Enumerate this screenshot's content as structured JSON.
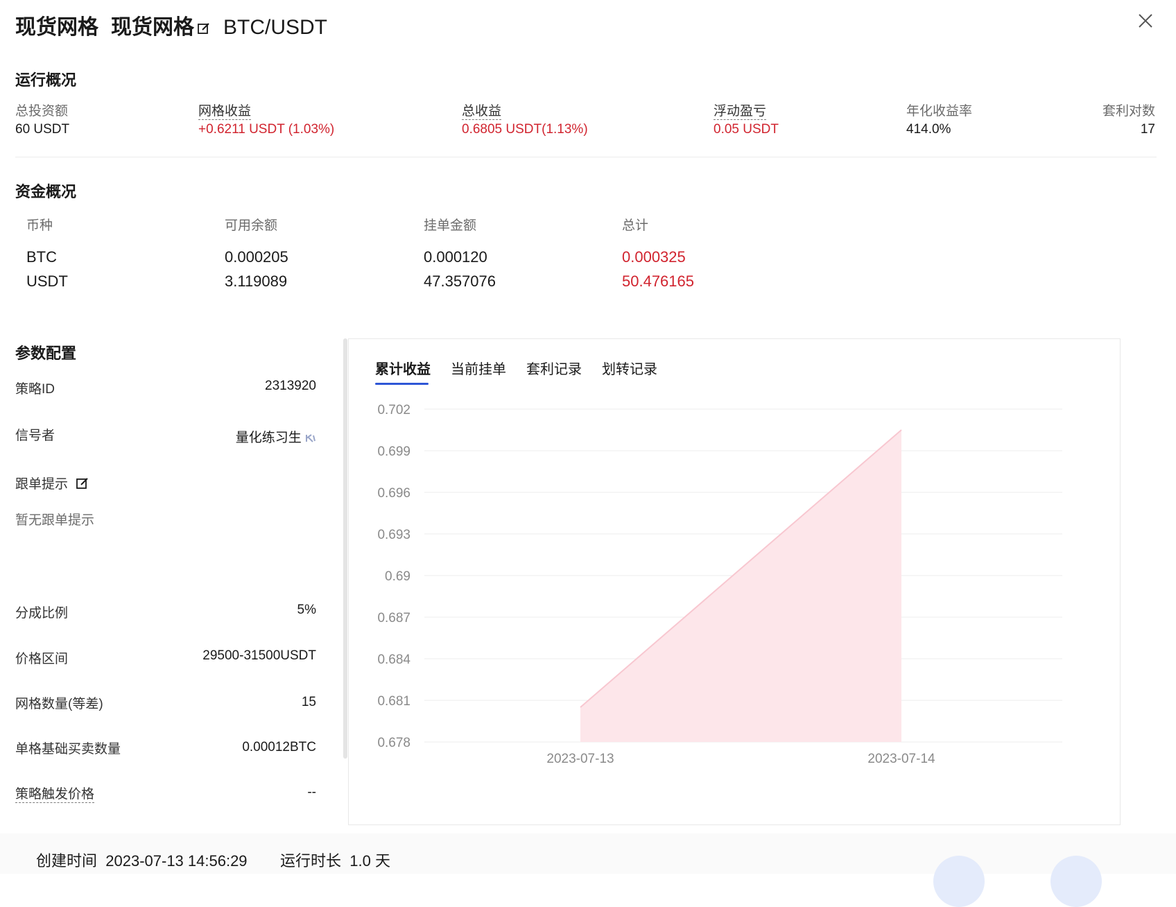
{
  "header": {
    "title_main": "现货网格",
    "title_sub": "现货网格",
    "pair": "BTC/USDT"
  },
  "overview": {
    "title": "运行概况",
    "items": [
      {
        "label": "总投资额",
        "value": "60 USDT"
      },
      {
        "label": "网格收益",
        "value": "+0.6211 USDT (1.03%)"
      },
      {
        "label": "总收益",
        "value": "0.6805 USDT(1.13%)"
      },
      {
        "label": "浮动盈亏",
        "value": "0.05 USDT"
      },
      {
        "label": "年化收益率",
        "value": "414.0%"
      },
      {
        "label": "套利对数",
        "value": "17"
      }
    ]
  },
  "funds": {
    "title": "资金概况",
    "headers": [
      "币种",
      "可用余额",
      "挂单金额",
      "总计"
    ],
    "rows": [
      [
        "BTC",
        "0.000205",
        "0.000120",
        "0.000325"
      ],
      [
        "USDT",
        "3.119089",
        "47.357076",
        "50.476165"
      ]
    ]
  },
  "params": {
    "title": "参数配置",
    "strategy_id_label": "策略ID",
    "strategy_id": "2313920",
    "signaler_label": "信号者",
    "signaler": "量化练习生",
    "tip_label": "跟单提示",
    "tip_empty": "暂无跟单提示",
    "share_label": "分成比例",
    "share": "5%",
    "range_label": "价格区间",
    "range": "29500-31500USDT",
    "grids_label": "网格数量(等差)",
    "grids": "15",
    "qty_label": "单格基础买卖数量",
    "qty": "0.00012BTC",
    "trigger_label": "策略触发价格",
    "trigger": "--"
  },
  "tabs": [
    "累计收益",
    "当前挂单",
    "套利记录",
    "划转记录"
  ],
  "chart_data": {
    "type": "area",
    "x": [
      "2023-07-13",
      "2023-07-14"
    ],
    "series": [
      {
        "values": [
          0.6805,
          0.7005
        ]
      }
    ],
    "y_ticks": [
      "0.702",
      "0.699",
      "0.696",
      "0.693",
      "0.69",
      "0.687",
      "0.684",
      "0.681",
      "0.678"
    ],
    "ylim": [
      0.678,
      0.702
    ],
    "grid": true,
    "colors": {
      "fill": "#fde6ea",
      "line": "#f8c7d0"
    }
  },
  "footer": {
    "created_label": "创建时间",
    "created": "2023-07-13 14:56:29",
    "runtime_label": "运行时长",
    "runtime": "1.0 天"
  },
  "colors": {
    "accent": "#2e56d6",
    "positive": "#d1242f"
  }
}
